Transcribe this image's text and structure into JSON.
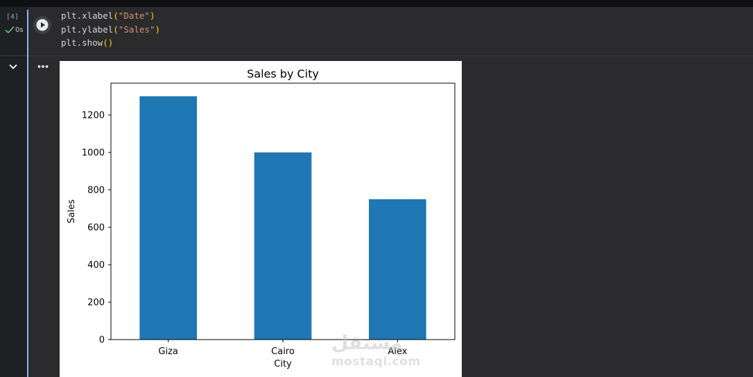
{
  "cell": {
    "execution_count": "[4]",
    "execution_time": "0s",
    "code_lines": [
      [
        {
          "t": "plt.xlabel",
          "c": "plain"
        },
        {
          "t": "(",
          "c": "paren"
        },
        {
          "t": "\"Date\"",
          "c": "str"
        },
        {
          "t": ")",
          "c": "paren"
        }
      ],
      [
        {
          "t": "plt.ylabel",
          "c": "plain"
        },
        {
          "t": "(",
          "c": "paren"
        },
        {
          "t": "\"Sales\"",
          "c": "str"
        },
        {
          "t": ")",
          "c": "paren"
        }
      ],
      [
        {
          "t": "plt.show",
          "c": "plain"
        },
        {
          "t": "()",
          "c": "paren"
        }
      ]
    ],
    "status_icon": "check-icon",
    "run_icon": "play-icon"
  },
  "output": {
    "collapse_icon": "chevron-down-icon",
    "menu_icon": "more-horiz-icon"
  },
  "colors": {
    "bar": "#1f77b4",
    "check": "#5bb974",
    "string": "#ce9178",
    "paren": "#ffd700"
  },
  "chart_data": {
    "type": "bar",
    "title": "Sales by City",
    "xlabel": "City",
    "ylabel": "Sales",
    "categories": [
      "Giza",
      "Cairo",
      "Alex"
    ],
    "values": [
      1300,
      1000,
      750
    ],
    "ylim": [
      0,
      1370
    ],
    "yticks": [
      0,
      200,
      400,
      600,
      800,
      1000,
      1200
    ],
    "grid": false
  },
  "watermark": {
    "logo_text": "مستقل",
    "url": "mostaql.com"
  }
}
